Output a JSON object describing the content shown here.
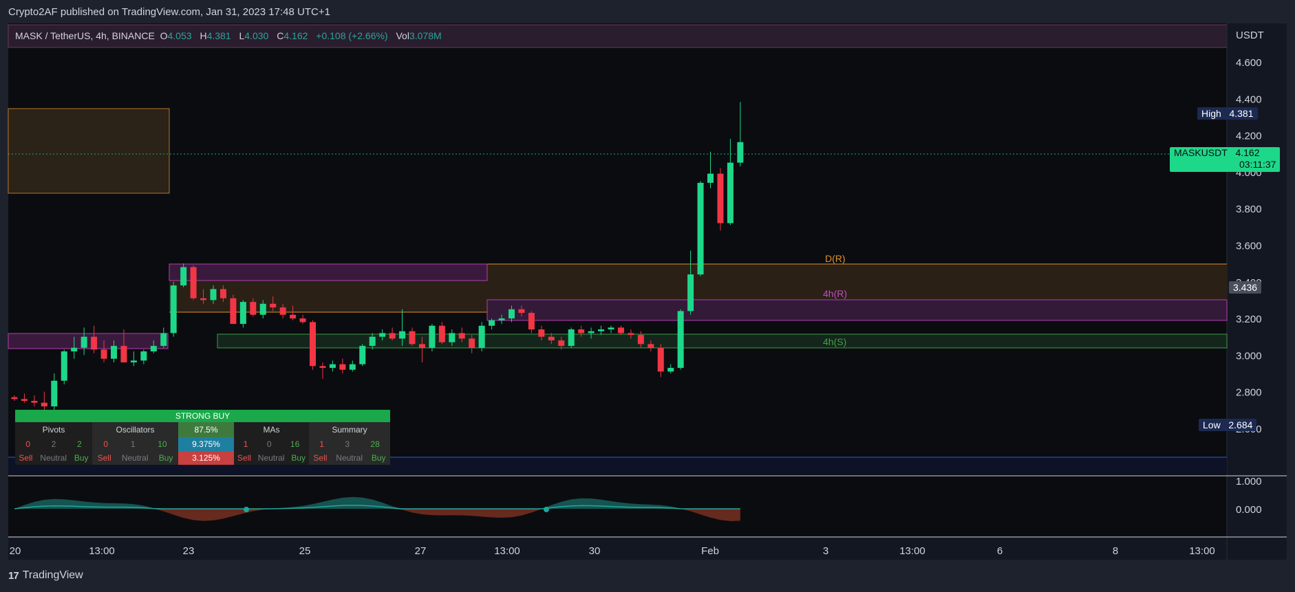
{
  "publisher": "Crypto2AF published on TradingView.com, Jan 31, 2023 17:48 UTC+1",
  "symbol_line": {
    "symbol": "MASK / TetherUS, 4h, BINANCE",
    "o_label": "O",
    "o": "4.053",
    "h_label": "H",
    "h": "4.381",
    "l_label": "L",
    "l": "4.030",
    "c_label": "C",
    "c": "4.162",
    "change": "+0.108 (+2.66%)",
    "vol_label": "Vol",
    "vol": "3.078M"
  },
  "axis": {
    "currency": "USDT",
    "price_ticks": [
      "4.600",
      "4.400",
      "4.200",
      "4.000",
      "3.800",
      "3.600",
      "3.400",
      "3.200",
      "3.000",
      "2.800",
      "2.600"
    ],
    "osc_ticks": [
      "1.000",
      "0.000"
    ],
    "time_ticks": [
      "20",
      "13:00",
      "23",
      "25",
      "27",
      "13:00",
      "30",
      "Feb",
      "3",
      "13:00",
      "6",
      "8",
      "13:00"
    ]
  },
  "tags": {
    "high_label": "High",
    "high_value": "4.381",
    "low_label": "Low",
    "low_value": "2.684",
    "last_symbol": "MASKUSDT",
    "last_value": "4.162",
    "countdown": "03:11:37",
    "level_value": "3.436"
  },
  "zones": {
    "d_r": "D(R)",
    "h4_r": "4h(R)",
    "h4_s": "4h(S)"
  },
  "tech_table": {
    "title": "STRONG BUY",
    "pivots": {
      "label": "Pivots",
      "sell": "0",
      "neutral": "2",
      "buy": "2"
    },
    "oscillators": {
      "label": "Oscillators",
      "sell": "0",
      "neutral": "1",
      "buy": "10"
    },
    "pct": {
      "label": "87.5%",
      "mid": "9.375%",
      "low": "3.125%"
    },
    "mas": {
      "label": "MAs",
      "sell": "1",
      "neutral": "0",
      "buy": "16"
    },
    "summary": {
      "label": "Summary",
      "sell": "1",
      "neutral": "3",
      "buy": "28"
    },
    "sell_label": "Sell",
    "neutral_label": "Neutral",
    "buy_label": "Buy"
  },
  "footer": {
    "brand": "TradingView"
  },
  "chart_data": {
    "type": "candlestick",
    "symbol": "MASK / TetherUS",
    "interval": "4h",
    "ylim": [
      2.5,
      4.75
    ],
    "candles": [
      [
        2.77,
        2.78,
        2.75,
        2.76
      ],
      [
        2.76,
        2.79,
        2.74,
        2.75
      ],
      [
        2.75,
        2.78,
        2.72,
        2.74
      ],
      [
        2.74,
        2.8,
        2.7,
        2.72
      ],
      [
        2.72,
        2.9,
        2.7,
        2.86
      ],
      [
        2.86,
        3.03,
        2.84,
        3.02
      ],
      [
        3.02,
        3.1,
        2.98,
        3.04
      ],
      [
        3.04,
        3.15,
        3.0,
        3.1
      ],
      [
        3.1,
        3.16,
        3.01,
        3.03
      ],
      [
        3.03,
        3.08,
        2.96,
        2.98
      ],
      [
        2.98,
        3.08,
        2.96,
        3.05
      ],
      [
        3.05,
        3.14,
        2.97,
        2.96
      ],
      [
        2.96,
        3.02,
        2.94,
        2.97
      ],
      [
        2.97,
        3.03,
        2.95,
        3.02
      ],
      [
        3.02,
        3.08,
        3.01,
        3.05
      ],
      [
        3.05,
        3.15,
        3.04,
        3.12
      ],
      [
        3.12,
        3.4,
        3.1,
        3.38
      ],
      [
        3.38,
        3.5,
        3.37,
        3.48
      ],
      [
        3.48,
        3.49,
        3.3,
        3.31
      ],
      [
        3.31,
        3.36,
        3.28,
        3.3
      ],
      [
        3.3,
        3.38,
        3.28,
        3.36
      ],
      [
        3.36,
        3.38,
        3.29,
        3.31
      ],
      [
        3.31,
        3.33,
        3.17,
        3.17
      ],
      [
        3.17,
        3.3,
        3.15,
        3.29
      ],
      [
        3.29,
        3.31,
        3.21,
        3.22
      ],
      [
        3.22,
        3.3,
        3.2,
        3.28
      ],
      [
        3.28,
        3.32,
        3.24,
        3.26
      ],
      [
        3.26,
        3.28,
        3.2,
        3.22
      ],
      [
        3.22,
        3.27,
        3.19,
        3.2
      ],
      [
        3.2,
        3.22,
        3.17,
        3.18
      ],
      [
        3.18,
        3.19,
        2.92,
        2.94
      ],
      [
        2.94,
        2.96,
        2.87,
        2.93
      ],
      [
        2.93,
        2.97,
        2.91,
        2.95
      ],
      [
        2.95,
        2.98,
        2.9,
        2.92
      ],
      [
        2.92,
        2.97,
        2.91,
        2.95
      ],
      [
        2.95,
        3.06,
        2.94,
        3.05
      ],
      [
        3.05,
        3.12,
        3.03,
        3.1
      ],
      [
        3.1,
        3.14,
        3.08,
        3.12
      ],
      [
        3.12,
        3.15,
        3.08,
        3.09
      ],
      [
        3.09,
        3.25,
        3.05,
        3.13
      ],
      [
        3.13,
        3.15,
        3.05,
        3.06
      ],
      [
        3.06,
        3.1,
        2.96,
        3.04
      ],
      [
        3.04,
        3.17,
        3.02,
        3.16
      ],
      [
        3.16,
        3.18,
        3.06,
        3.07
      ],
      [
        3.07,
        3.14,
        3.05,
        3.12
      ],
      [
        3.12,
        3.15,
        3.07,
        3.09
      ],
      [
        3.09,
        3.11,
        3.01,
        3.04
      ],
      [
        3.04,
        3.18,
        3.02,
        3.16
      ],
      [
        3.16,
        3.2,
        3.14,
        3.19
      ],
      [
        3.19,
        3.22,
        3.17,
        3.2
      ],
      [
        3.2,
        3.27,
        3.18,
        3.25
      ],
      [
        3.25,
        3.27,
        3.21,
        3.23
      ],
      [
        3.23,
        3.24,
        3.12,
        3.14
      ],
      [
        3.14,
        3.16,
        3.08,
        3.1
      ],
      [
        3.1,
        3.12,
        3.06,
        3.08
      ],
      [
        3.08,
        3.1,
        3.03,
        3.05
      ],
      [
        3.05,
        3.15,
        3.04,
        3.14
      ],
      [
        3.14,
        3.16,
        3.1,
        3.12
      ],
      [
        3.12,
        3.15,
        3.09,
        3.13
      ],
      [
        3.13,
        3.16,
        3.11,
        3.14
      ],
      [
        3.14,
        3.16,
        3.12,
        3.15
      ],
      [
        3.15,
        3.16,
        3.11,
        3.12
      ],
      [
        3.12,
        3.14,
        3.09,
        3.11
      ],
      [
        3.11,
        3.13,
        3.04,
        3.06
      ],
      [
        3.06,
        3.08,
        3.02,
        3.04
      ],
      [
        3.04,
        3.06,
        2.88,
        2.91
      ],
      [
        2.91,
        2.95,
        2.9,
        2.93
      ],
      [
        2.93,
        3.25,
        2.92,
        3.24
      ],
      [
        3.24,
        3.57,
        3.22,
        3.44
      ],
      [
        3.44,
        3.95,
        3.43,
        3.94
      ],
      [
        3.94,
        4.11,
        3.91,
        3.99
      ],
      [
        3.99,
        4.02,
        3.68,
        3.72
      ],
      [
        3.72,
        4.18,
        3.71,
        4.05
      ],
      [
        4.05,
        4.381,
        4.03,
        4.162
      ]
    ]
  }
}
